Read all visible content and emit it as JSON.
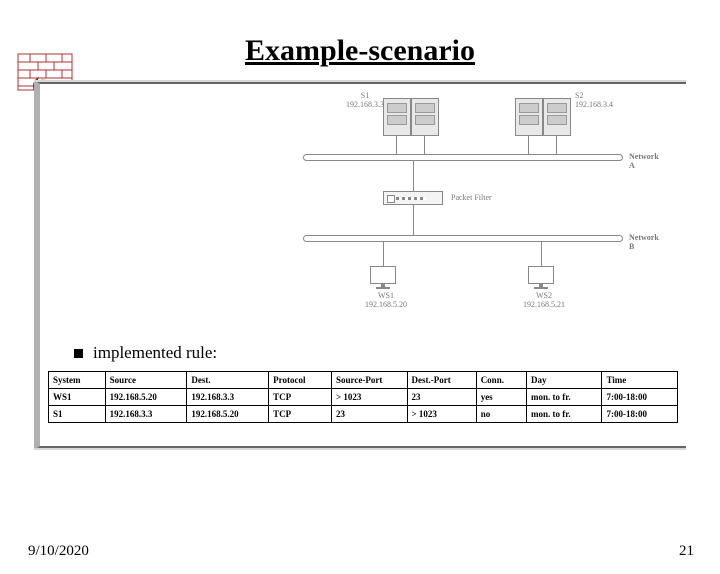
{
  "slide": {
    "title": "Example-scenario",
    "bullet": "implemented rule:",
    "date": "9/10/2020",
    "page": "21"
  },
  "diagram": {
    "s1_name": "S1",
    "s1_ip": "192.168.3.3",
    "s2_name": "S2",
    "s2_ip": "192.168.3.4",
    "net_a": "Network A",
    "filter": "Packet Filter",
    "net_b": "Network B",
    "ws1_name": "WS1",
    "ws1_ip": "192.168.5.20",
    "ws2_name": "WS2",
    "ws2_ip": "192.168.5.21"
  },
  "table": {
    "headers": [
      "System",
      "Source",
      "Dest.",
      "Protocol",
      "Source-Port",
      "Dest.-Port",
      "Conn.",
      "Day",
      "Time"
    ],
    "rows": [
      [
        "WS1",
        "192.168.5.20",
        "192.168.3.3",
        "TCP",
        "> 1023",
        "23",
        "yes",
        "mon. to fr.",
        "7:00-18:00"
      ],
      [
        "S1",
        "192.168.3.3",
        "192.168.5.20",
        "TCP",
        "23",
        "> 1023",
        "no",
        "mon. to fr.",
        "7:00-18:00"
      ]
    ]
  }
}
